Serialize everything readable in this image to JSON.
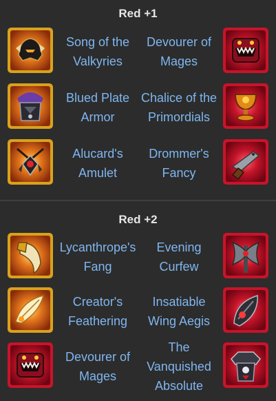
{
  "sections": [
    {
      "title": "Red +1",
      "rows": [
        {
          "left": {
            "name": "Song of the Valkyries",
            "icon": "valkyrie-helmet-icon",
            "frame": "gold"
          },
          "right": {
            "name": "Devourer of Mages",
            "icon": "devourer-tome-icon",
            "frame": "red"
          }
        },
        {
          "left": {
            "name": "Blued Plate Armor",
            "icon": "plate-armor-icon",
            "frame": "gold"
          },
          "right": {
            "name": "Chalice of the Primordials",
            "icon": "chalice-icon",
            "frame": "red"
          }
        },
        {
          "left": {
            "name": "Alucard's Amulet",
            "icon": "amulet-icon",
            "frame": "gold"
          },
          "right": {
            "name": "Drommer's Fancy",
            "icon": "pistol-icon",
            "frame": "red"
          }
        }
      ]
    },
    {
      "title": "Red +2",
      "rows": [
        {
          "left": {
            "name": "Lycanthrope's Fang",
            "icon": "fang-icon",
            "frame": "gold"
          },
          "right": {
            "name": "Evening Curfew",
            "icon": "axe-icon",
            "frame": "red"
          }
        },
        {
          "left": {
            "name": "Creator's Feathering",
            "icon": "feathering-icon",
            "frame": "gold"
          },
          "right": {
            "name": "Insatiable Wing Aegis",
            "icon": "wing-aegis-icon",
            "frame": "red"
          }
        },
        {
          "left": {
            "name": "Devourer of Mages",
            "icon": "devourer-tome-icon",
            "frame": "red"
          },
          "right": {
            "name": "The Vanquished Absolute",
            "icon": "vanquished-armor-icon",
            "frame": "red"
          }
        }
      ]
    }
  ],
  "colors": {
    "background": "#2c2c2c",
    "title": "#e6e6e6",
    "item_name": "#7fb6f0",
    "gold_frame": "#d9a21c",
    "red_frame": "#c8142a"
  }
}
